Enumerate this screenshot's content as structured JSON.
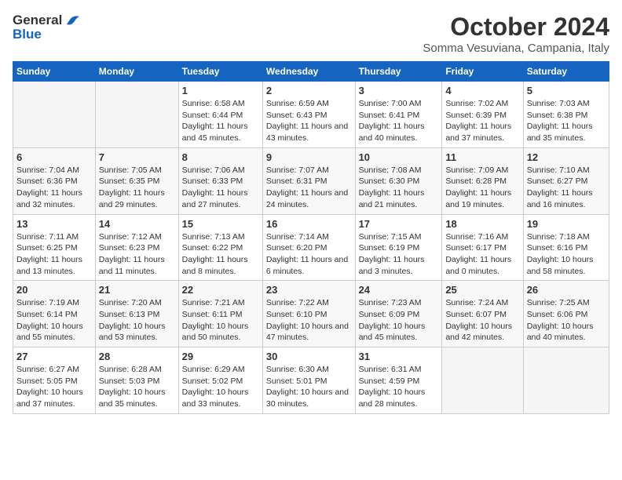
{
  "app": {
    "logo_general": "General",
    "logo_blue": "Blue",
    "month_title": "October 2024",
    "location": "Somma Vesuviana, Campania, Italy"
  },
  "calendar": {
    "weekdays": [
      "Sunday",
      "Monday",
      "Tuesday",
      "Wednesday",
      "Thursday",
      "Friday",
      "Saturday"
    ],
    "days": [
      {
        "day": "",
        "empty": true
      },
      {
        "day": "",
        "empty": true
      },
      {
        "day": "1",
        "sunrise": "Sunrise: 6:58 AM",
        "sunset": "Sunset: 6:44 PM",
        "daylight": "Daylight: 11 hours and 45 minutes."
      },
      {
        "day": "2",
        "sunrise": "Sunrise: 6:59 AM",
        "sunset": "Sunset: 6:43 PM",
        "daylight": "Daylight: 11 hours and 43 minutes."
      },
      {
        "day": "3",
        "sunrise": "Sunrise: 7:00 AM",
        "sunset": "Sunset: 6:41 PM",
        "daylight": "Daylight: 11 hours and 40 minutes."
      },
      {
        "day": "4",
        "sunrise": "Sunrise: 7:02 AM",
        "sunset": "Sunset: 6:39 PM",
        "daylight": "Daylight: 11 hours and 37 minutes."
      },
      {
        "day": "5",
        "sunrise": "Sunrise: 7:03 AM",
        "sunset": "Sunset: 6:38 PM",
        "daylight": "Daylight: 11 hours and 35 minutes."
      },
      {
        "day": "6",
        "sunrise": "Sunrise: 7:04 AM",
        "sunset": "Sunset: 6:36 PM",
        "daylight": "Daylight: 11 hours and 32 minutes."
      },
      {
        "day": "7",
        "sunrise": "Sunrise: 7:05 AM",
        "sunset": "Sunset: 6:35 PM",
        "daylight": "Daylight: 11 hours and 29 minutes."
      },
      {
        "day": "8",
        "sunrise": "Sunrise: 7:06 AM",
        "sunset": "Sunset: 6:33 PM",
        "daylight": "Daylight: 11 hours and 27 minutes."
      },
      {
        "day": "9",
        "sunrise": "Sunrise: 7:07 AM",
        "sunset": "Sunset: 6:31 PM",
        "daylight": "Daylight: 11 hours and 24 minutes."
      },
      {
        "day": "10",
        "sunrise": "Sunrise: 7:08 AM",
        "sunset": "Sunset: 6:30 PM",
        "daylight": "Daylight: 11 hours and 21 minutes."
      },
      {
        "day": "11",
        "sunrise": "Sunrise: 7:09 AM",
        "sunset": "Sunset: 6:28 PM",
        "daylight": "Daylight: 11 hours and 19 minutes."
      },
      {
        "day": "12",
        "sunrise": "Sunrise: 7:10 AM",
        "sunset": "Sunset: 6:27 PM",
        "daylight": "Daylight: 11 hours and 16 minutes."
      },
      {
        "day": "13",
        "sunrise": "Sunrise: 7:11 AM",
        "sunset": "Sunset: 6:25 PM",
        "daylight": "Daylight: 11 hours and 13 minutes."
      },
      {
        "day": "14",
        "sunrise": "Sunrise: 7:12 AM",
        "sunset": "Sunset: 6:23 PM",
        "daylight": "Daylight: 11 hours and 11 minutes."
      },
      {
        "day": "15",
        "sunrise": "Sunrise: 7:13 AM",
        "sunset": "Sunset: 6:22 PM",
        "daylight": "Daylight: 11 hours and 8 minutes."
      },
      {
        "day": "16",
        "sunrise": "Sunrise: 7:14 AM",
        "sunset": "Sunset: 6:20 PM",
        "daylight": "Daylight: 11 hours and 6 minutes."
      },
      {
        "day": "17",
        "sunrise": "Sunrise: 7:15 AM",
        "sunset": "Sunset: 6:19 PM",
        "daylight": "Daylight: 11 hours and 3 minutes."
      },
      {
        "day": "18",
        "sunrise": "Sunrise: 7:16 AM",
        "sunset": "Sunset: 6:17 PM",
        "daylight": "Daylight: 11 hours and 0 minutes."
      },
      {
        "day": "19",
        "sunrise": "Sunrise: 7:18 AM",
        "sunset": "Sunset: 6:16 PM",
        "daylight": "Daylight: 10 hours and 58 minutes."
      },
      {
        "day": "20",
        "sunrise": "Sunrise: 7:19 AM",
        "sunset": "Sunset: 6:14 PM",
        "daylight": "Daylight: 10 hours and 55 minutes."
      },
      {
        "day": "21",
        "sunrise": "Sunrise: 7:20 AM",
        "sunset": "Sunset: 6:13 PM",
        "daylight": "Daylight: 10 hours and 53 minutes."
      },
      {
        "day": "22",
        "sunrise": "Sunrise: 7:21 AM",
        "sunset": "Sunset: 6:11 PM",
        "daylight": "Daylight: 10 hours and 50 minutes."
      },
      {
        "day": "23",
        "sunrise": "Sunrise: 7:22 AM",
        "sunset": "Sunset: 6:10 PM",
        "daylight": "Daylight: 10 hours and 47 minutes."
      },
      {
        "day": "24",
        "sunrise": "Sunrise: 7:23 AM",
        "sunset": "Sunset: 6:09 PM",
        "daylight": "Daylight: 10 hours and 45 minutes."
      },
      {
        "day": "25",
        "sunrise": "Sunrise: 7:24 AM",
        "sunset": "Sunset: 6:07 PM",
        "daylight": "Daylight: 10 hours and 42 minutes."
      },
      {
        "day": "26",
        "sunrise": "Sunrise: 7:25 AM",
        "sunset": "Sunset: 6:06 PM",
        "daylight": "Daylight: 10 hours and 40 minutes."
      },
      {
        "day": "27",
        "sunrise": "Sunrise: 6:27 AM",
        "sunset": "Sunset: 5:05 PM",
        "daylight": "Daylight: 10 hours and 37 minutes."
      },
      {
        "day": "28",
        "sunrise": "Sunrise: 6:28 AM",
        "sunset": "Sunset: 5:03 PM",
        "daylight": "Daylight: 10 hours and 35 minutes."
      },
      {
        "day": "29",
        "sunrise": "Sunrise: 6:29 AM",
        "sunset": "Sunset: 5:02 PM",
        "daylight": "Daylight: 10 hours and 33 minutes."
      },
      {
        "day": "30",
        "sunrise": "Sunrise: 6:30 AM",
        "sunset": "Sunset: 5:01 PM",
        "daylight": "Daylight: 10 hours and 30 minutes."
      },
      {
        "day": "31",
        "sunrise": "Sunrise: 6:31 AM",
        "sunset": "Sunset: 4:59 PM",
        "daylight": "Daylight: 10 hours and 28 minutes."
      },
      {
        "day": "",
        "empty": true
      },
      {
        "day": "",
        "empty": true
      }
    ]
  }
}
